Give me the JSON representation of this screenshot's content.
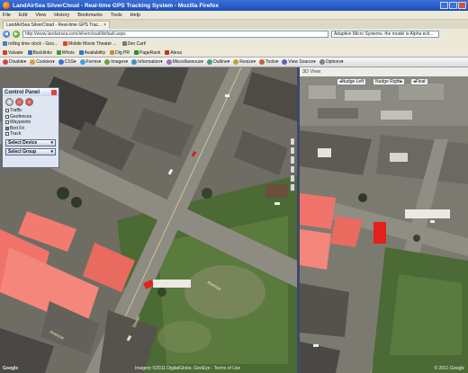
{
  "window": {
    "title": "LandAirSea SilverCloud - Real-time GPS Tracking System - Mozilla Firefox"
  },
  "menu": [
    "File",
    "Edit",
    "View",
    "History",
    "Bookmarks",
    "Tools",
    "Help"
  ],
  "tabs": [
    {
      "label": "LandAirSea SilverCloud - Real-time GPS Trac..."
    }
  ],
  "nav": {
    "url": "http://www.landairsea.com/silvercloud/default.aspx",
    "search": "Adaptive Micro Systems. the model is Alpha ecli..."
  },
  "bookmarks_row1": [
    {
      "label": "rolling time clock - Goo...",
      "color": "#3a7fd6"
    },
    {
      "label": "Mobile Movie Theater ...",
      "color": "#d64a2a"
    },
    {
      "label": "Zen Cart!",
      "color": "#7a7a7a"
    }
  ],
  "bookmarks_row2": [
    {
      "label": "Valuate",
      "color": "#cc3b3b"
    },
    {
      "label": "Backlinks",
      "color": "#3b6fcc"
    },
    {
      "label": "Whois",
      "color": "#3b9a3b"
    },
    {
      "label": "Availability",
      "color": "#3b6fcc"
    },
    {
      "label": "Dig PR",
      "color": "#cc8b3b"
    },
    {
      "label": "PageRank",
      "color": "#2f8f2f"
    },
    {
      "label": "Alexa",
      "color": "#c03030"
    }
  ],
  "appbar": [
    {
      "label": "Disable▾",
      "color": "#d64040"
    },
    {
      "label": "Cookies▾",
      "color": "#d6a040"
    },
    {
      "label": "CSS▾",
      "color": "#4070d6"
    },
    {
      "label": "Forms▾",
      "color": "#40a0d6"
    },
    {
      "label": "Images▾",
      "color": "#70a040"
    },
    {
      "label": "Information▾",
      "color": "#4090c0"
    },
    {
      "label": "Miscellaneous▾",
      "color": "#a070c0"
    },
    {
      "label": "Outline▾",
      "color": "#40a070"
    },
    {
      "label": "Resize▾",
      "color": "#c0a040"
    },
    {
      "label": "Tools▾",
      "color": "#c06040"
    },
    {
      "label": "View Source▾",
      "color": "#6060c0"
    },
    {
      "label": "Options▾",
      "color": "#808080"
    }
  ],
  "control_panel": {
    "title": "Control Panel",
    "layers": [
      {
        "label": "Traffic",
        "checked": false
      },
      {
        "label": "Geofences",
        "checked": false
      },
      {
        "label": "Waypoints",
        "checked": false
      },
      {
        "label": "Bird Fit",
        "checked": true
      },
      {
        "label": "Track",
        "checked": false
      }
    ],
    "select_device": "Select Device",
    "select_group": "Select Group"
  },
  "view3d": {
    "title": "3D View",
    "nudge_left": "Nudge Left",
    "nudge_right": "Nudge Right",
    "float": "Float",
    "copyright": "© 2011 Google"
  },
  "map": {
    "street_labels": [
      "Avenue",
      "Street",
      "Avenue"
    ],
    "copyright": "Imagery ©2011 DigitalGlobe, GeoEye - Terms of Use",
    "logo": "Google"
  },
  "colors": {
    "rooftop_red": "#f0736a",
    "vehicle_red": "#e3201b",
    "grass": "#4a6b33",
    "road": "#8c8a80"
  }
}
